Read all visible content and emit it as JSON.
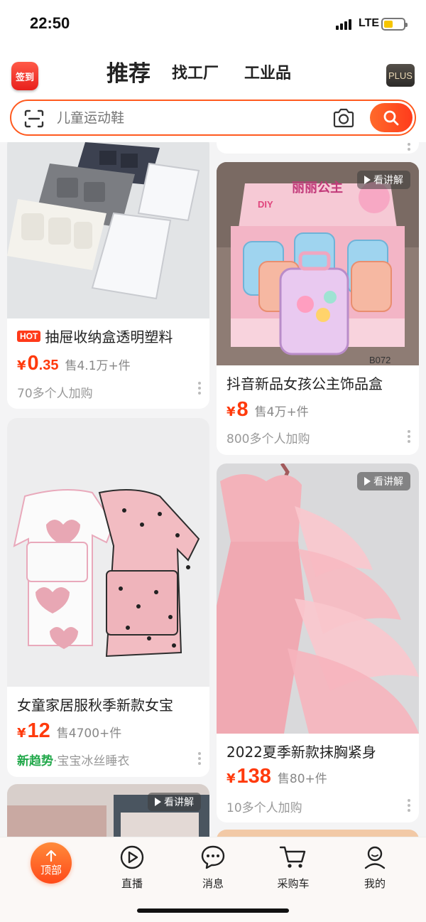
{
  "status": {
    "time": "22:50",
    "network": "LTE",
    "battery_level": 0.48
  },
  "header": {
    "checkin_label": "签到",
    "tabs": [
      {
        "label": "推荐",
        "active": true
      },
      {
        "label": "找工厂",
        "active": false
      },
      {
        "label": "工业品",
        "active": false
      }
    ],
    "plus_label": "PLUS"
  },
  "search": {
    "placeholder": "儿童运动鞋",
    "icons": [
      "scan-icon",
      "camera-icon",
      "search-icon"
    ]
  },
  "products": [
    {
      "hot_label": "HOT",
      "title": "抽屉收纳盒透明塑料",
      "price_int": "0",
      "price_dec": ".35",
      "yen": "¥",
      "sold": "售4.1万+件",
      "meta": "70多个人加购"
    },
    {
      "badge": "看讲解",
      "title": "抖音新品女孩公主饰品盒",
      "yen": "¥",
      "price_int": "8",
      "sold": "售4万+件",
      "meta": "800多个人加购",
      "image_text": [
        "丽丽公主",
        "DIY",
        "B072"
      ]
    },
    {
      "title": "女童家居服秋季新款女宝",
      "yen": "¥",
      "price_int": "12",
      "sold": "售4700+件",
      "meta_trend": "新趋势",
      "meta": "·宝宝冰丝睡衣"
    },
    {
      "badge": "看讲解",
      "title": "2022夏季新款抹胸紧身",
      "yen": "¥",
      "price_int": "138",
      "sold": "售80+件",
      "meta": "10多个人加购"
    },
    {
      "badge": "看讲解"
    }
  ],
  "bottom_nav": {
    "top_label": "顶部",
    "items": [
      {
        "label": "直播",
        "icon": "play-icon"
      },
      {
        "label": "消息",
        "icon": "chat-icon"
      },
      {
        "label": "采购车",
        "icon": "cart-icon"
      },
      {
        "label": "我的",
        "icon": "user-icon"
      }
    ]
  },
  "colors": {
    "accent": "#ff4a1a",
    "price": "#ff3a0c",
    "trend": "#21a84a"
  }
}
